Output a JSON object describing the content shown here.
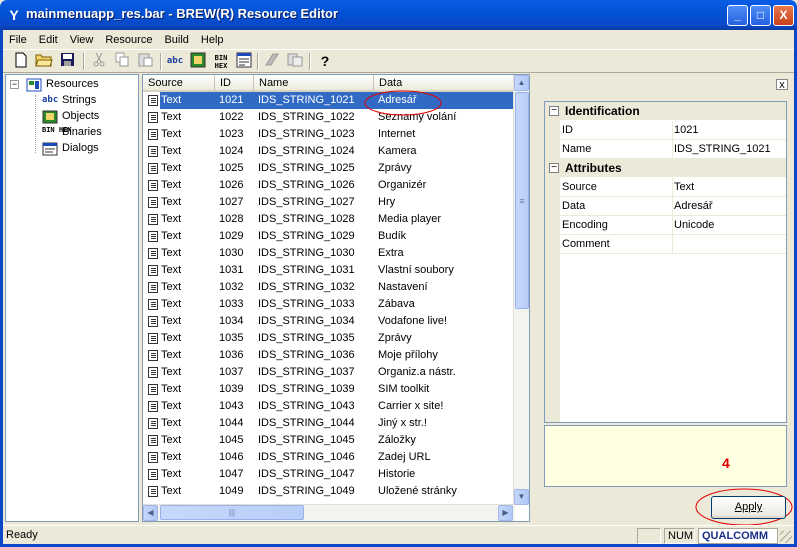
{
  "window": {
    "title": "mainmenuapp_res.bar - BREW(R) Resource Editor",
    "app_icon": "Y",
    "btn_minimize": "_",
    "btn_maximize": "□",
    "btn_close": "X"
  },
  "menu": [
    "File",
    "Edit",
    "View",
    "Resource",
    "Build",
    "Help"
  ],
  "toolbar": {
    "icons": [
      "new-file-icon",
      "open-folder-icon",
      "save-icon",
      "cut-icon",
      "copy-icon",
      "paste-icon",
      "new-string-icon",
      "new-object-icon",
      "new-binary-icon",
      "new-dialog-icon",
      "compile-icon",
      "build-icon",
      "help-icon"
    ],
    "string_glyph": "abc",
    "binary_glyph": "BIN HEX",
    "help_glyph": "?"
  },
  "tree": {
    "root": "Resources",
    "collapse_glyph": "−",
    "children": [
      "Strings",
      "Objects",
      "Binaries",
      "Dialogs"
    ],
    "strings_glyph": "abc",
    "binaries_glyph": "BIN HEX"
  },
  "list": {
    "columns": [
      "Source",
      "ID",
      "Name",
      "Data"
    ],
    "rows": [
      {
        "source": "Text",
        "id": "1021",
        "name": "IDS_STRING_1021",
        "data": "Adresář"
      },
      {
        "source": "Text",
        "id": "1022",
        "name": "IDS_STRING_1022",
        "data": "Seznamy volání"
      },
      {
        "source": "Text",
        "id": "1023",
        "name": "IDS_STRING_1023",
        "data": "Internet"
      },
      {
        "source": "Text",
        "id": "1024",
        "name": "IDS_STRING_1024",
        "data": "Kamera"
      },
      {
        "source": "Text",
        "id": "1025",
        "name": "IDS_STRING_1025",
        "data": "Zprávy"
      },
      {
        "source": "Text",
        "id": "1026",
        "name": "IDS_STRING_1026",
        "data": "Organizér"
      },
      {
        "source": "Text",
        "id": "1027",
        "name": "IDS_STRING_1027",
        "data": "Hry"
      },
      {
        "source": "Text",
        "id": "1028",
        "name": "IDS_STRING_1028",
        "data": "Media player"
      },
      {
        "source": "Text",
        "id": "1029",
        "name": "IDS_STRING_1029",
        "data": "Budík"
      },
      {
        "source": "Text",
        "id": "1030",
        "name": "IDS_STRING_1030",
        "data": "Extra"
      },
      {
        "source": "Text",
        "id": "1031",
        "name": "IDS_STRING_1031",
        "data": "Vlastní soubory"
      },
      {
        "source": "Text",
        "id": "1032",
        "name": "IDS_STRING_1032",
        "data": "Nastavení"
      },
      {
        "source": "Text",
        "id": "1033",
        "name": "IDS_STRING_1033",
        "data": "Zábava"
      },
      {
        "source": "Text",
        "id": "1034",
        "name": "IDS_STRING_1034",
        "data": "Vodafone live!"
      },
      {
        "source": "Text",
        "id": "1035",
        "name": "IDS_STRING_1035",
        "data": "Zprávy"
      },
      {
        "source": "Text",
        "id": "1036",
        "name": "IDS_STRING_1036",
        "data": "Moje přílohy"
      },
      {
        "source": "Text",
        "id": "1037",
        "name": "IDS_STRING_1037",
        "data": "Organiz.a nástr."
      },
      {
        "source": "Text",
        "id": "1039",
        "name": "IDS_STRING_1039",
        "data": "SIM toolkit"
      },
      {
        "source": "Text",
        "id": "1043",
        "name": "IDS_STRING_1043",
        "data": "Carrier x site!"
      },
      {
        "source": "Text",
        "id": "1044",
        "name": "IDS_STRING_1044",
        "data": "Jiný x str.!"
      },
      {
        "source": "Text",
        "id": "1045",
        "name": "IDS_STRING_1045",
        "data": "Záložky"
      },
      {
        "source": "Text",
        "id": "1046",
        "name": "IDS_STRING_1046",
        "data": "Zadej URL"
      },
      {
        "source": "Text",
        "id": "1047",
        "name": "IDS_STRING_1047",
        "data": "Historie"
      },
      {
        "source": "Text",
        "id": "1049",
        "name": "IDS_STRING_1049",
        "data": "Uložené stránky"
      }
    ],
    "selected_index": 0,
    "hscroll_thumb_glyph": "|||",
    "vscroll_thumb_glyph": "≡"
  },
  "properties": {
    "close_glyph": "x",
    "collapse_glyph": "−",
    "categories": {
      "identification": "Identification",
      "attributes": "Attributes"
    },
    "identification_rows": [
      {
        "label": "ID",
        "value": "1021"
      },
      {
        "label": "Name",
        "value": "IDS_STRING_1021"
      }
    ],
    "attribute_rows": [
      {
        "label": "Source",
        "value": "Text"
      },
      {
        "label": "Data",
        "value": "Adresář"
      },
      {
        "label": "Encoding",
        "value": "Unicode"
      },
      {
        "label": "Comment",
        "value": ""
      }
    ],
    "apply_label": "Apply",
    "annotation_number": "4"
  },
  "status": {
    "text": "Ready",
    "num": "NUM",
    "logo": "QUALCOMM"
  },
  "colors": {
    "annotation": "#e00000",
    "selection": "#316ac5",
    "titlebar": "#0a5ce6"
  }
}
